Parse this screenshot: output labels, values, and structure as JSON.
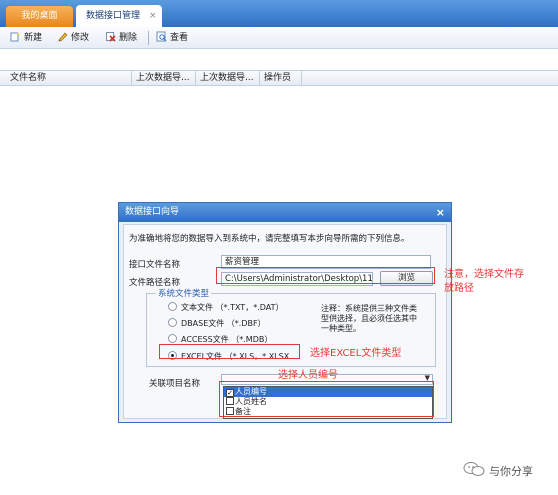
{
  "tabs": {
    "home_label": "我的桌面",
    "active_label": "数据接口管理",
    "close_glyph": "×"
  },
  "toolbar": {
    "new_label": "新建",
    "edit_label": "修改",
    "delete_label": "删除",
    "view_label": "查看"
  },
  "grid": {
    "columns": [
      "文件名称",
      "上次数据导...",
      "上次数据导...",
      "操作员"
    ]
  },
  "dialog": {
    "title": "数据接口向导",
    "close_glyph": "×",
    "intro": "为准确地将您的数据导入到系统中，请完整填写本步向导所需的下列信息。",
    "interface_name_label": "接口文件名称",
    "interface_name_value": "薪资管理",
    "file_path_label": "文件路径名称",
    "file_path_value": "C:\\Users\\Administrator\\Desktop\\113.xls",
    "browse_label": "浏览",
    "group_title": "系统文件类型",
    "file_types": [
      {
        "label": "文本文件 （*.TXT，*.DAT）",
        "selected": false
      },
      {
        "label": "DBASE文件 （*.DBF）",
        "selected": false
      },
      {
        "label": "ACCESS文件 （*.MDB）",
        "selected": false
      },
      {
        "label": "EXCEL文件 （*.XLS，*.XLSX",
        "selected": true
      }
    ],
    "note": "注释：系统提供三种文件类型供选择，且必须任选其中一种类型。",
    "related_label": "关联项目名称",
    "dropdown_items": [
      {
        "label": "人员编号",
        "checked": true,
        "highlighted": true
      },
      {
        "label": "人员姓名",
        "checked": false,
        "highlighted": false
      },
      {
        "label": "备注",
        "checked": false,
        "highlighted": false
      }
    ]
  },
  "annotations": {
    "path_note_line1": "注意，选择文件存",
    "path_note_line2": "放路径",
    "excel_note": "选择EXCEL文件类型",
    "person_note": "选择人员编号"
  },
  "watermark": {
    "text": "与你分享"
  },
  "colors": {
    "title_bar": "#2e6ec4",
    "home_tab": "#e8861c",
    "annotation_red": "#e53935",
    "selection_blue": "#3170d0"
  }
}
